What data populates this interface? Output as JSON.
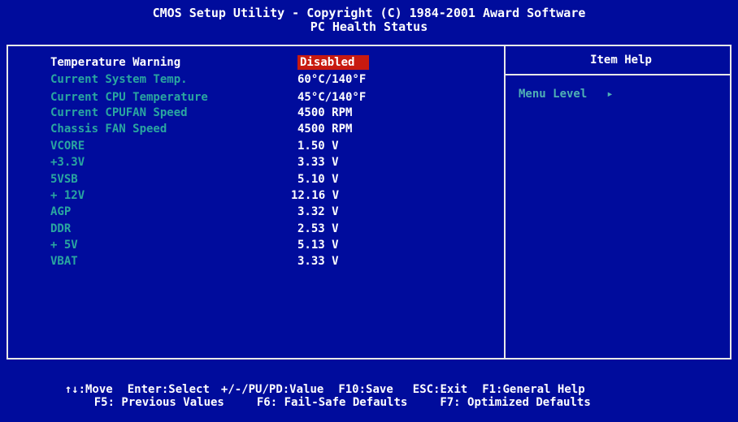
{
  "header": {
    "line1": "CMOS Setup Utility - Copyright (C) 1984-2001 Award Software",
    "line2": "PC Health Status"
  },
  "settings": [
    {
      "label": "Temperature Warning",
      "value": "Disabled",
      "selected": true
    },
    {
      "label": "Current System Temp.",
      "value": "60°C/140°F"
    },
    {
      "label": "Current CPU Temperature",
      "value": "45°C/140°F"
    },
    {
      "label": "Current CPUFAN Speed",
      "value": "4500 RPM"
    },
    {
      "label": "Chassis FAN Speed",
      "value": "4500 RPM"
    },
    {
      "label": "VCORE",
      "value": "1.50 V"
    },
    {
      "label": "+3.3V",
      "value": "3.33 V"
    },
    {
      "label": "5VSB",
      "value": "5.10 V"
    },
    {
      "label": "+ 12V",
      "value": "12.16 V"
    },
    {
      "label": "AGP",
      "value": "3.32 V"
    },
    {
      "label": "DDR",
      "value": "2.53 V"
    },
    {
      "label": "+  5V",
      "value": "5.13 V"
    },
    {
      "label": "VBAT",
      "value": "3.33 V"
    }
  ],
  "help": {
    "title": "Item Help",
    "menu_level_label": "Menu Level",
    "menu_level_arrow": "▸"
  },
  "footer": {
    "move": "↑↓:Move",
    "enter": "Enter:Select",
    "value": "+/-/PU/PD:Value",
    "save": "F10:Save",
    "exit": "ESC:Exit",
    "general_help": "F1:General Help",
    "previous": "F5: Previous Values",
    "failsafe": "F6: Fail-Safe Defaults",
    "optimized": "F7: Optimized Defaults"
  },
  "colors": {
    "background": "#000c9c",
    "label_active": "#ffffff",
    "label_inactive": "#2aa6a0",
    "selection": "#c81a10"
  }
}
